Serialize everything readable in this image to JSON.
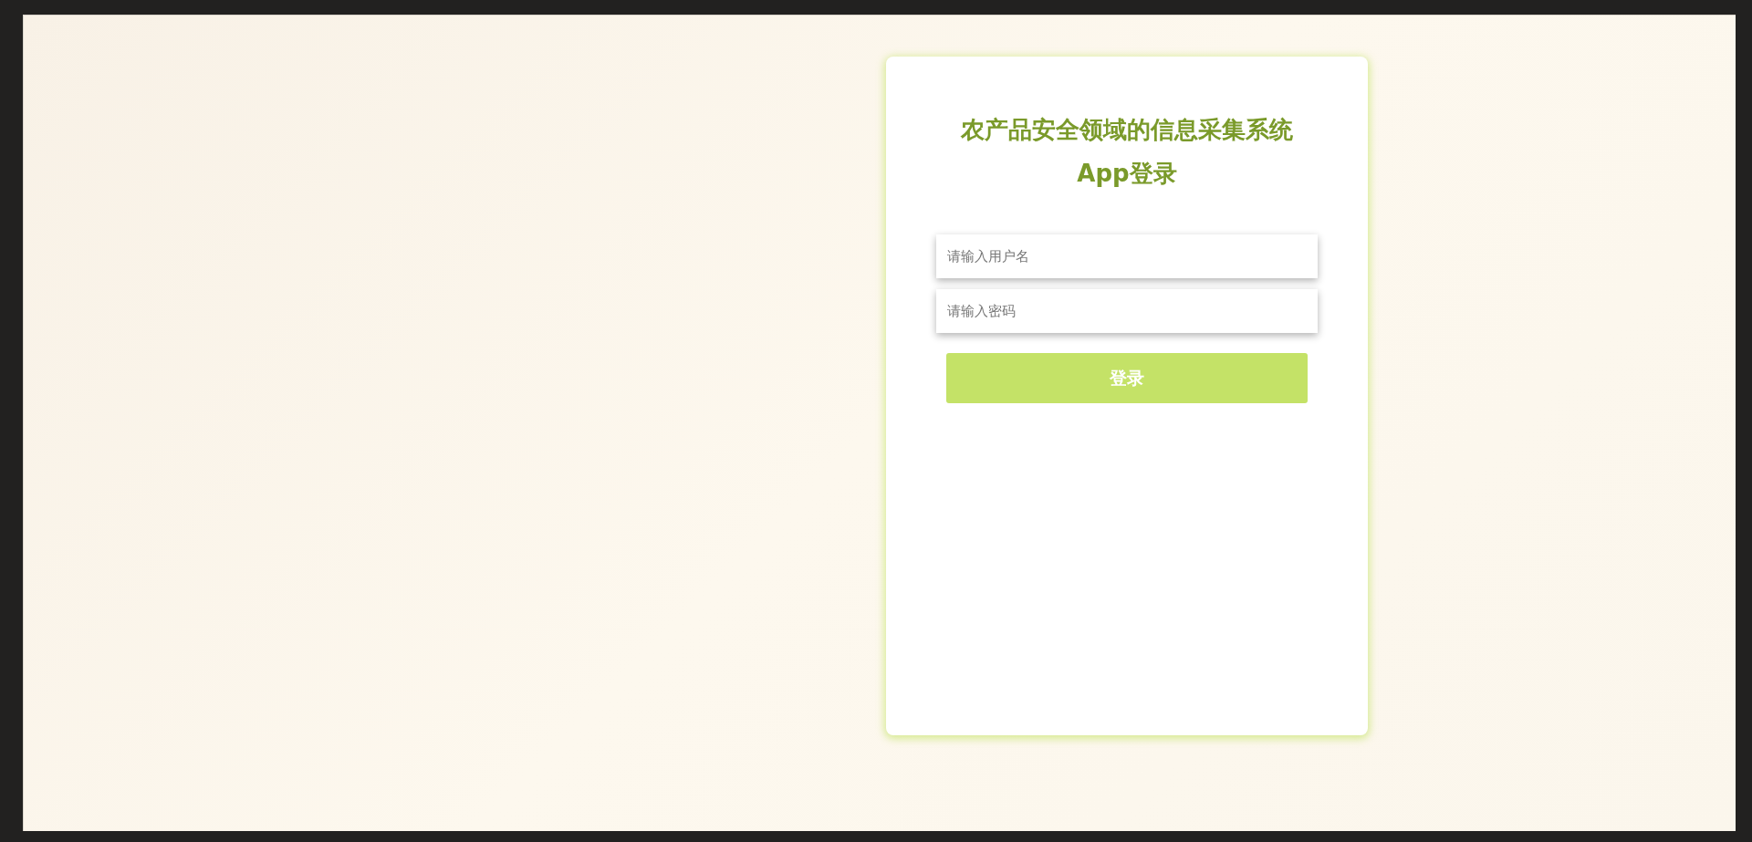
{
  "login_card": {
    "title_lines": [
      "农产品安全领域的信息采集系统",
      "App登录"
    ],
    "fields": [
      {
        "placeholder": "请输入用户名"
      },
      {
        "placeholder": "请输入密码"
      }
    ],
    "submit_button": "登录"
  }
}
